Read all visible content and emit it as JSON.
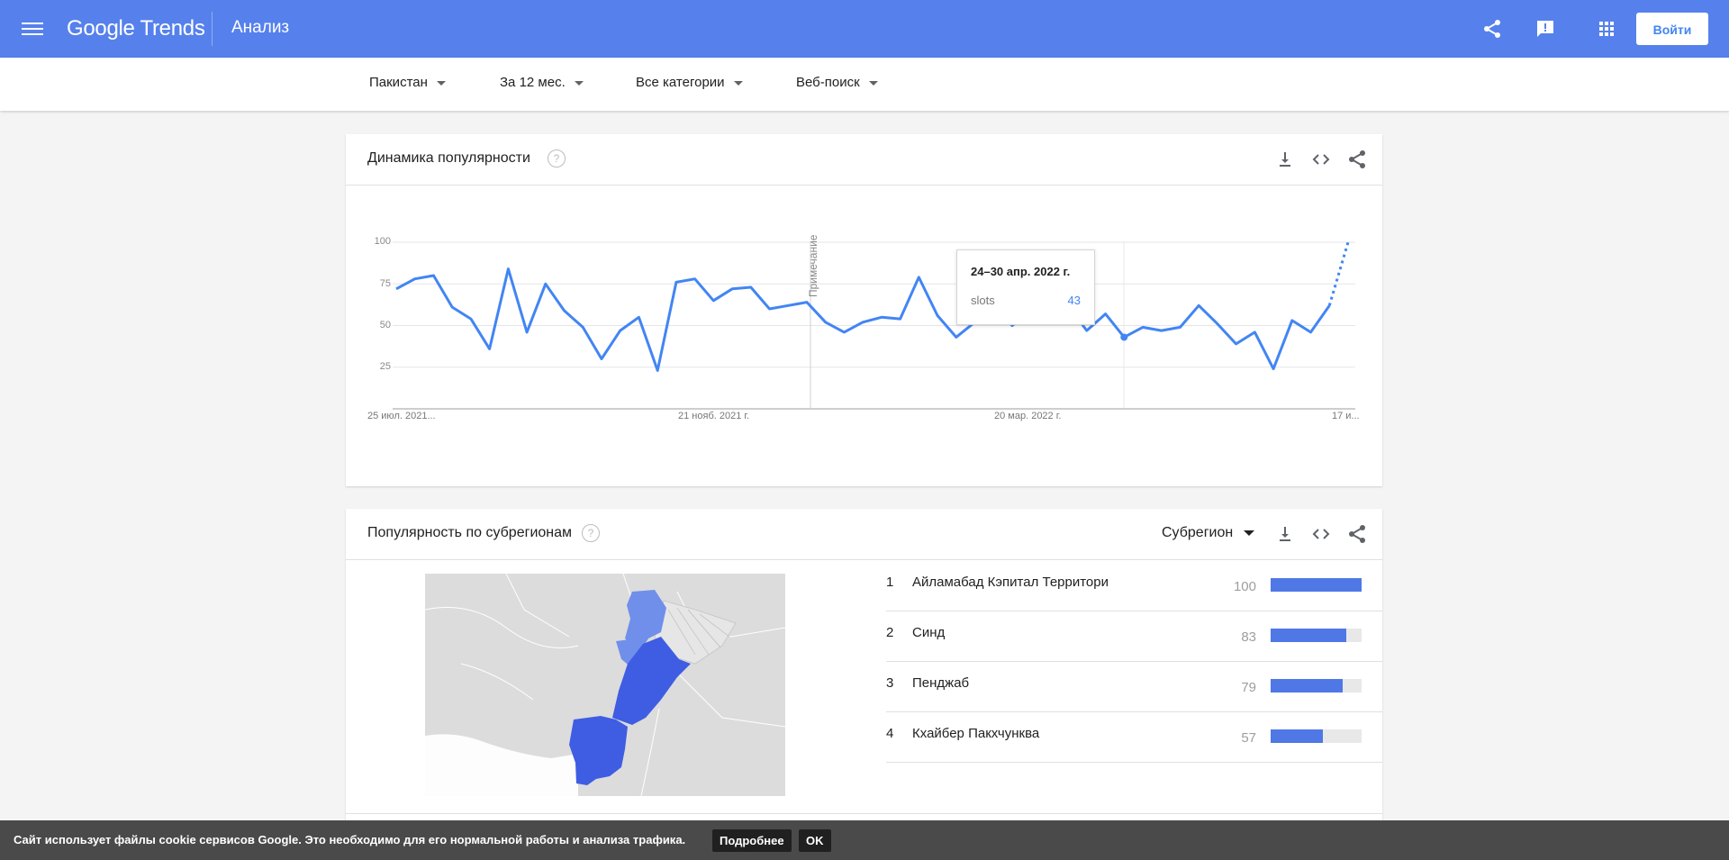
{
  "header": {
    "logo": "Google Trends",
    "title": "Анализ",
    "signin_label": "Войти"
  },
  "filters": [
    {
      "label": "Пакистан"
    },
    {
      "label": "За 12 мес."
    },
    {
      "label": "Все категории"
    },
    {
      "label": "Веб-поиск"
    }
  ],
  "interest_over_time": {
    "title": "Динамика популярности",
    "help": "?",
    "note": "Примечание",
    "tooltip": {
      "date": "24–30 апр. 2022 г.",
      "series": "slots",
      "value": "43"
    },
    "y_ticks": [
      "100",
      "75",
      "50",
      "25"
    ],
    "x_ticks": [
      "25 июл. 2021...",
      "21 нояб. 2021 г.",
      "20 мар. 2022 г.",
      "17 и..."
    ]
  },
  "chart_data": {
    "type": "line",
    "series": [
      {
        "name": "slots",
        "color": "#4285f4",
        "values": [
          72,
          78,
          80,
          61,
          54,
          36,
          84,
          46,
          75,
          59,
          49,
          30,
          47,
          55,
          23,
          76,
          78,
          65,
          72,
          73,
          60,
          62,
          64,
          52,
          46,
          52,
          55,
          54,
          79,
          56,
          43,
          52,
          63,
          50,
          58,
          64,
          62,
          47,
          57,
          43,
          49,
          47,
          49,
          62,
          51,
          39,
          46,
          24,
          53,
          46,
          62,
          100
        ]
      }
    ],
    "partial_last_segment": true,
    "x_ticks": [
      "25 июл. 2021...",
      "21 нояб. 2021 г.",
      "20 мар. 2022 г.",
      "17 и..."
    ],
    "ylim": [
      0,
      100
    ],
    "grid": true
  },
  "subregions": {
    "title": "Популярность по субрегионам",
    "help": "?",
    "dropdown_label": "Субрегион",
    "rows": [
      {
        "rank": "1",
        "name": "Айламабад Кэпитал Территори",
        "value": "100",
        "fraction": 1.0
      },
      {
        "rank": "2",
        "name": "Синд",
        "value": "83",
        "fraction": 0.83
      },
      {
        "rank": "3",
        "name": "Пенджаб",
        "value": "79",
        "fraction": 0.79
      },
      {
        "rank": "4",
        "name": "Кхайбер Пакхчунква",
        "value": "57",
        "fraction": 0.57
      }
    ]
  },
  "cookie": {
    "text": "Сайт использует файлы cookie сервисов Google. Это необходимо для его нормальной работы и анализа трафика.",
    "more_label": "Подробнее",
    "ok_label": "OK"
  },
  "colors": {
    "header": "#5681ec",
    "accent": "#4285f4",
    "bar": "#4f78e6",
    "map_region": "#3f5de3"
  }
}
